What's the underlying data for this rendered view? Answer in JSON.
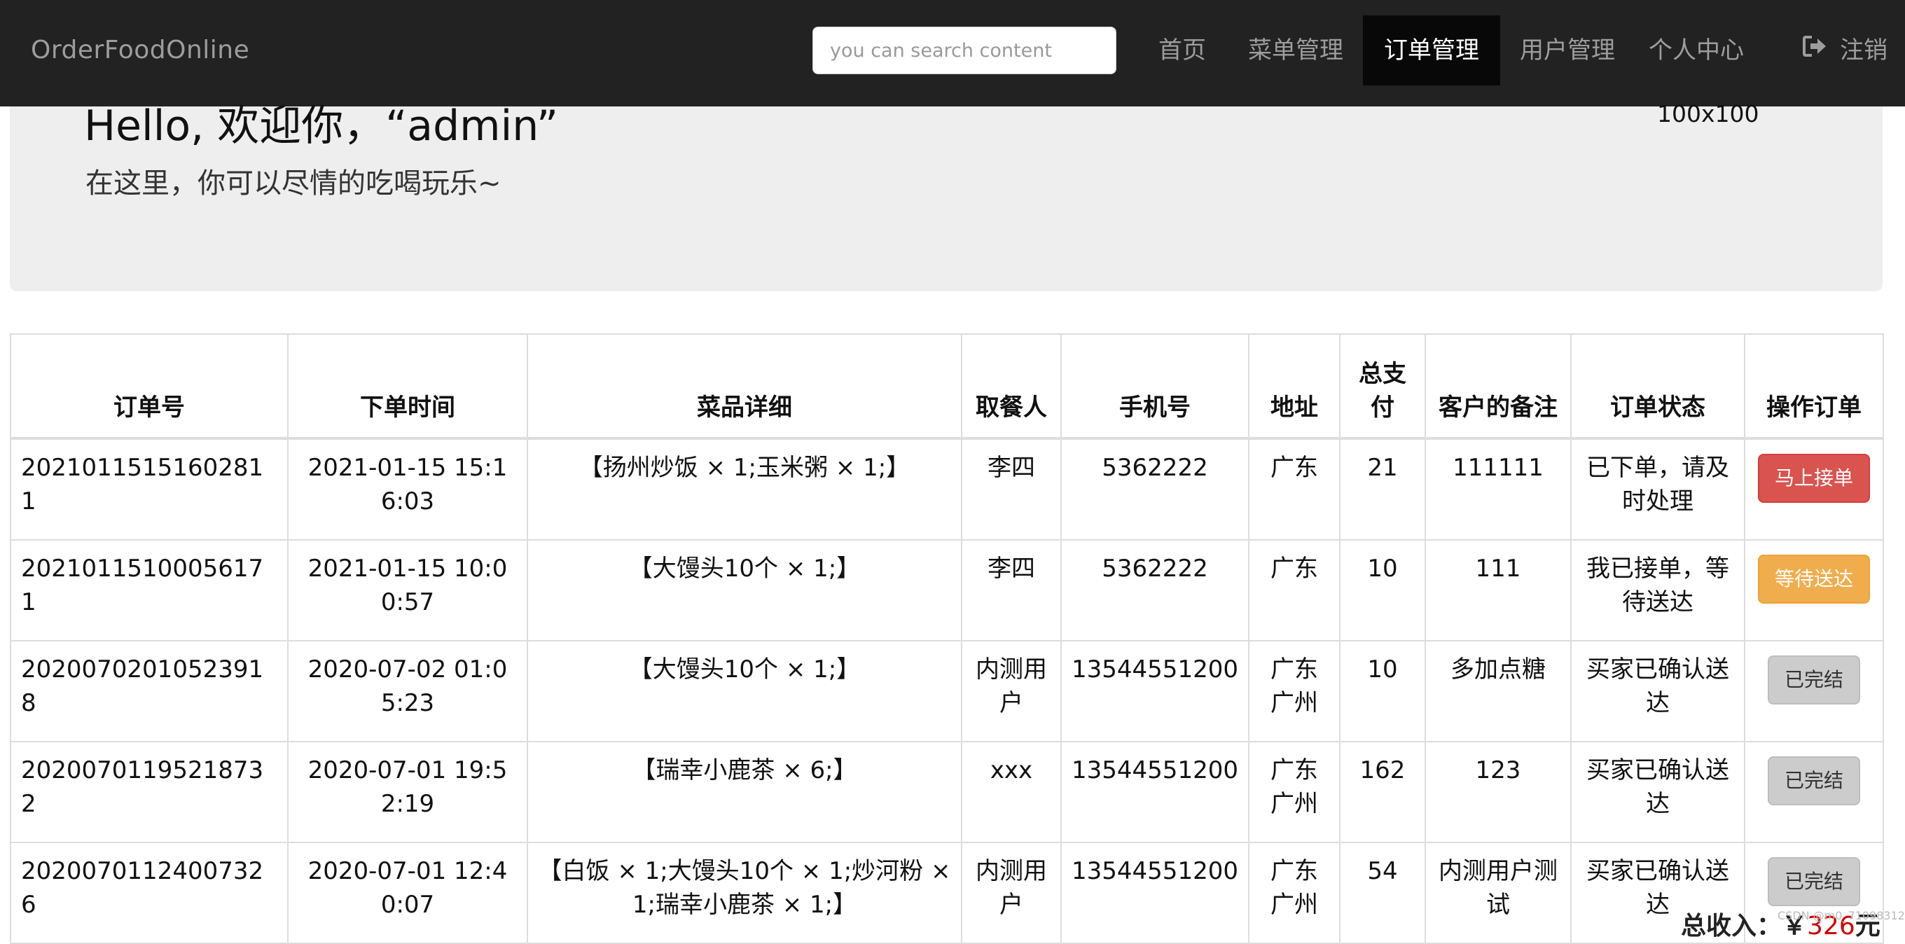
{
  "navbar": {
    "brand": "OrderFoodOnline",
    "search_placeholder": "you can search content",
    "items": [
      {
        "label": "首页",
        "active": false
      },
      {
        "label": "菜单管理",
        "active": false
      },
      {
        "label": "订单管理",
        "active": true
      },
      {
        "label": "用户管理",
        "active": false
      },
      {
        "label": "个人中心",
        "active": false
      }
    ],
    "logout_label": "注销",
    "logout_icon": "sign-out-icon"
  },
  "jumbotron": {
    "greeting": "Hello, 欢迎你，“admin”",
    "subtitle": "在这里，你可以尽情的吃喝玩乐~",
    "image_placeholder": "100x100"
  },
  "table": {
    "headers": [
      "订单号",
      "下单时间",
      "菜品详细",
      "取餐人",
      "手机号",
      "地址",
      "总支付",
      "客户的备注",
      "订单状态",
      "操作订单"
    ],
    "rows": [
      {
        "order_id": "20210115151602811",
        "time": "2021-01-15 15:16:03",
        "dishes": "【扬州炒饭 × 1;玉米粥 × 1;】",
        "receiver": "李四",
        "phone": "5362222",
        "address": "广东",
        "total": "21",
        "note": "111111",
        "status": "已下单，请及时处理",
        "action": "马上接单",
        "action_style": "danger"
      },
      {
        "order_id": "20210115100056171",
        "time": "2021-01-15 10:00:57",
        "dishes": "【大馒头10个 × 1;】",
        "receiver": "李四",
        "phone": "5362222",
        "address": "广东",
        "total": "10",
        "note": "111",
        "status": "我已接单，等待送达",
        "action": "等待送达",
        "action_style": "warning"
      },
      {
        "order_id": "20200702010523918",
        "time": "2020-07-02 01:05:23",
        "dishes": "【大馒头10个 × 1;】",
        "receiver": "内测用户",
        "phone": "13544551200",
        "address": "广东广州",
        "total": "10",
        "note": "多加点糖",
        "status": "买家已确认送达",
        "action": "已完结",
        "action_style": "default"
      },
      {
        "order_id": "20200701195218732",
        "time": "2020-07-01 19:52:19",
        "dishes": "【瑞幸小鹿茶 × 6;】",
        "receiver": "xxx",
        "phone": "13544551200",
        "address": "广东广州",
        "total": "162",
        "note": "123",
        "status": "买家已确认送达",
        "action": "已完结",
        "action_style": "default"
      },
      {
        "order_id": "20200701124007326",
        "time": "2020-07-01 12:40:07",
        "dishes": "【白饭 × 1;大馒头10个 × 1;炒河粉 × 1;瑞幸小鹿茶 × 1;】",
        "receiver": "内测用户",
        "phone": "13544551200",
        "address": "广东广州",
        "total": "54",
        "note": "内测用户测试",
        "status": "买家已确认送达",
        "action": "已完结",
        "action_style": "default"
      }
    ]
  },
  "summary": {
    "label": "总收入：",
    "currency": "￥",
    "amount": "326",
    "unit": "元"
  },
  "watermark": "CSDN @m0_71098312",
  "colors": {
    "navbar_bg": "#222222",
    "nav_active_bg": "#080808",
    "jumbotron_bg": "#eeeeee",
    "btn_danger": "#d9534f",
    "btn_warning": "#f0ad4e",
    "btn_default": "#cccccc",
    "total_amount": "#d00000"
  }
}
